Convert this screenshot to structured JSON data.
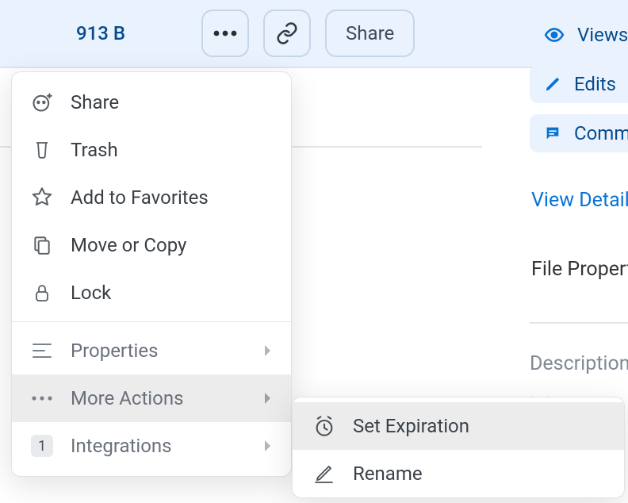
{
  "topbar": {
    "filesize": "913 B",
    "share_label": "Share"
  },
  "menu": {
    "items": [
      {
        "label": "Share"
      },
      {
        "label": "Trash"
      },
      {
        "label": "Add to Favorites"
      },
      {
        "label": "Move or Copy"
      },
      {
        "label": "Lock"
      }
    ],
    "secondary": [
      {
        "label": "Properties"
      },
      {
        "label": "More Actions"
      },
      {
        "label": "Integrations",
        "badge": "1"
      }
    ]
  },
  "submenu": {
    "items": [
      {
        "label": "Set Expiration"
      },
      {
        "label": "Rename"
      }
    ]
  },
  "stats": {
    "views": "Views",
    "edits": "Edits",
    "comments": "Comments"
  },
  "details_link": "View Details",
  "properties_title": "File Properties",
  "description_label": "Description",
  "placeholder_tail": "· ·"
}
